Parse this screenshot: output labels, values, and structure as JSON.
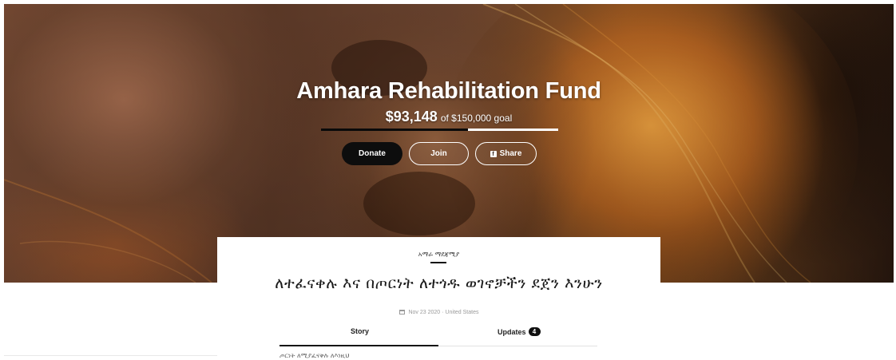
{
  "hero": {
    "title": "Amhara Rehabilitation Fund",
    "raised_amount": "$93,148",
    "goal_text": "of $150,000 goal",
    "progress_fraction": 0.621,
    "background_image": "lion-fire-photo"
  },
  "actions": {
    "donate_label": "Donate",
    "join_label": "Join",
    "share_label": "Share",
    "share_icon": "facebook-icon",
    "share_icon_glyph": "f"
  },
  "campaign": {
    "category": "አማራ ማደጃሚያ",
    "title": "ለተፈናቀሉ እና በጦርነት ለተጎዱ ወገኖቻችን ደጀን እንሁን",
    "date": "Nov 23 2020",
    "separator": "·",
    "location": "United States",
    "date_icon": "calendar-icon"
  },
  "tabs": {
    "story_label": "Story",
    "updates_label": "Updates",
    "updates_count": "4",
    "active": "story"
  },
  "story": {
    "preview_text": "ጦርነት ለሚያፈናቅሉ ለእነዚህ"
  },
  "colors": {
    "button_dark": "#0d0d0d",
    "text_dark": "#1a1a1a",
    "muted": "#9a9a9a"
  }
}
